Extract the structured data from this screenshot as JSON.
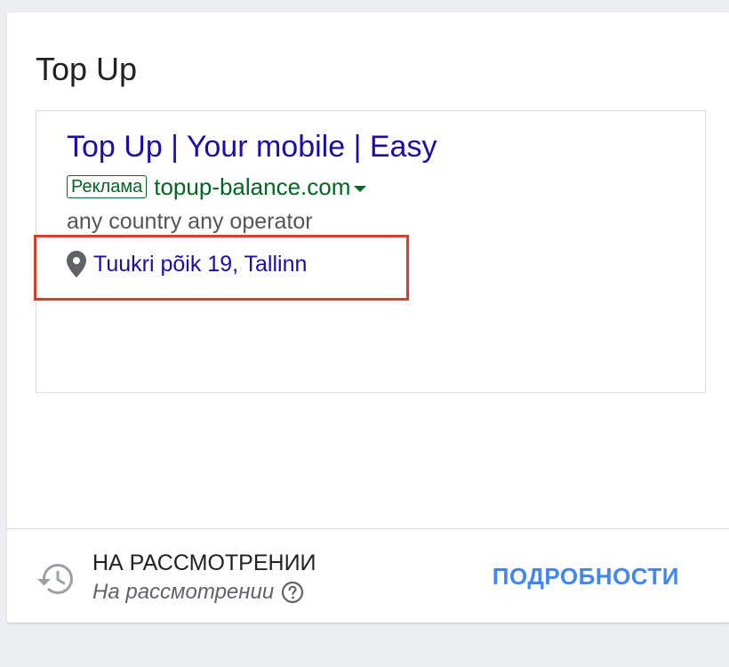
{
  "card": {
    "title": "Top Up"
  },
  "ad": {
    "headline": "Top Up | Your mobile | Easy",
    "badge": "Реклама",
    "display_url": "topup-balance.com",
    "description": "any country any operator",
    "location": "Tuukri põik 19, Tallinn",
    "location_icon": "map-pin-icon",
    "colors": {
      "headline": "#1a0dab",
      "url": "#006621",
      "description": "#545454",
      "highlight": "#d93d2d"
    }
  },
  "status": {
    "icon": "history-icon",
    "title": "НА РАССМОТРЕНИИ",
    "subtitle": "На рассмотрении",
    "help_icon": "help-circle-icon",
    "details_label": "ПОДРОБНОСТИ",
    "details_color": "#4285f4"
  }
}
